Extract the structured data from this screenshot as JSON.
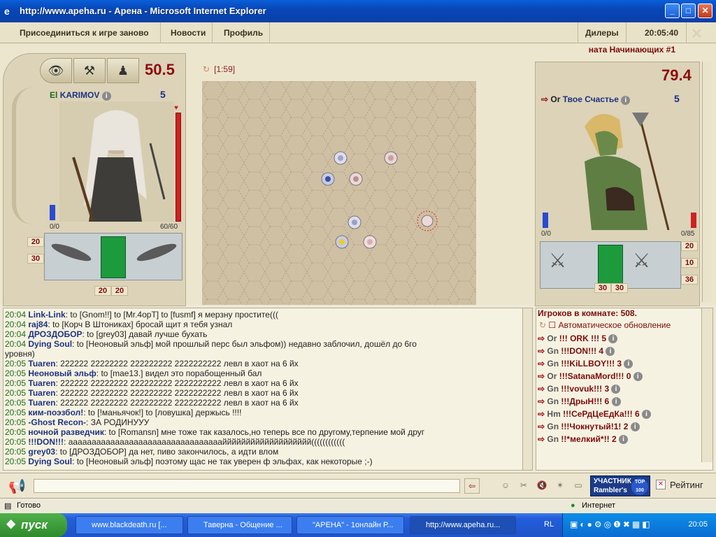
{
  "window": {
    "title": "http://www.apeha.ru - Арена - Microsoft Internet Explorer"
  },
  "menu": {
    "rejoin": "Присоединиться к игре заново",
    "news": "Новости",
    "profile": "Профиль",
    "dealers": "Дилеры",
    "time": "20:05:40"
  },
  "room": {
    "name": "ната Начинающих #1"
  },
  "battle": {
    "timer": "[1:59]"
  },
  "player_left": {
    "health_pct": "50.5",
    "race": "El",
    "name": "KARIMOV",
    "level": "5",
    "mana": "0/0",
    "hp": "60/60",
    "stat_a": "20",
    "stat_b": "30",
    "weapon_a": "20",
    "weapon_b": "20"
  },
  "player_right": {
    "health_pct": "79.4",
    "race": "Or",
    "name": "Твое Счастье",
    "level": "5",
    "mana": "0/0",
    "hp": "0/85",
    "stat_a": "20",
    "stat_b": "10",
    "stat_c": "36",
    "weapon_a": "30",
    "weapon_b": "30"
  },
  "chat": {
    "lines": [
      {
        "time": "20:04",
        "nick": "Link-Link",
        "text": ": to [Gnom!!] to [Mr.4opT] to [fusmf] я мерзну простите((("
      },
      {
        "time": "20:04",
        "nick": "raj84",
        "text": ": to [Корч В Штониках] бросай щит я тебя узнал"
      },
      {
        "time": "20:04",
        "nick": "ДРОЗДОБОР",
        "text": ": to [grey03] давай лучше бухать"
      },
      {
        "time": "20:04",
        "nick": "Dying Soul",
        "text": ": to [Неоновый эльф] мой прошлый перс был эльфом)) недавно заблочил, дошёл до 6го"
      },
      {
        "time": "",
        "nick": "",
        "text": "уровня)"
      },
      {
        "time": "20:05",
        "nick": "Tuaren",
        "text": ": 222222 22222222 222222222 2222222222 левл в хаот на 6 йх"
      },
      {
        "time": "20:05",
        "nick": "Неоновый эльф",
        "text": ": to [mae13.] видел это порабощенный бал"
      },
      {
        "time": "20:05",
        "nick": "Tuaren",
        "text": ": 222222 22222222 222222222 2222222222 левл в хаот на 6 йх"
      },
      {
        "time": "20:05",
        "nick": "Tuaren",
        "text": ": 222222 22222222 222222222 2222222222 левл в хаот на 6 йх"
      },
      {
        "time": "20:05",
        "nick": "Tuaren",
        "text": ": 222222 22222222 222222222 2222222222 левл в хаот на 6 йх"
      },
      {
        "time": "20:05",
        "nick": "ким-поэзбол!",
        "text": ": to [!маньячок!] to [ловушка] держысь !!!!"
      },
      {
        "time": "20:05",
        "nick": "-Ghost Recon-",
        "text": ": ЗА РОДИНУУУ"
      },
      {
        "time": "20:05",
        "nick": "ночной разведчик",
        "text": ": to [Romansn] мне тоже так казалось,но теперь все по другому,терпение мой друг"
      },
      {
        "time": "20:05",
        "nick": "!!!DON!!!",
        "text": ": аааааааааааааааааааааааааааааааааййййййййййййййййййй(((((((((((("
      },
      {
        "time": "20:05",
        "nick": "grey03",
        "text": ": to [ДРОЗДОБОР] да нет, пиво закончилось, а идти влом"
      },
      {
        "time": "20:05",
        "nick": "Dying Soul",
        "text": ": to [Неоновый эльф] поэтому щас не так уверен ф эльфах, как некоторые ;-)"
      }
    ]
  },
  "players": {
    "header": "Игроков в комнате: 508.",
    "auto_update": "Автоматическое обновление",
    "list": [
      {
        "race": "Or",
        "name": "!!! ORK !!!",
        "level": "5"
      },
      {
        "race": "Gn",
        "name": "!!!DON!!!",
        "level": "4"
      },
      {
        "race": "Gn",
        "name": "!!!KiLLBOY!!!",
        "level": "3"
      },
      {
        "race": "Or",
        "name": "!!!SatanaMord!!!",
        "level": "0"
      },
      {
        "race": "Gn",
        "name": "!!!vovuk!!!",
        "level": "3"
      },
      {
        "race": "Gn",
        "name": "!!!ДрыН!!!",
        "level": "6"
      },
      {
        "race": "Hm",
        "name": "!!!СеРдЦеЕдКа!!!",
        "level": "6"
      },
      {
        "race": "Gn",
        "name": "!!!Чокнутый!1!",
        "level": "2"
      },
      {
        "race": "Gn",
        "name": "!!*мелкий*!!",
        "level": "2"
      }
    ]
  },
  "input": {
    "rating": "Рейтинг",
    "banner_top": "УЧАСТНИК",
    "banner_bottom": "Rambler's",
    "banner_badge": "TOP 100"
  },
  "status": {
    "ready": "Готово",
    "zone": "Интернет"
  },
  "taskbar": {
    "start": "пуск",
    "tasks": [
      "www.blackdeath.ru [...",
      "Таверна - Общение ...",
      "\"АРЕНА\" - 1онлайн Р...",
      "http://www.apeha.ru..."
    ],
    "lang": "RL",
    "clock": "20:05"
  },
  "colors": {
    "accent": "#8b0d0d",
    "title_blue": "#0a4fc8",
    "taskbar": "#245edb",
    "arena": "#cfbfa3"
  }
}
